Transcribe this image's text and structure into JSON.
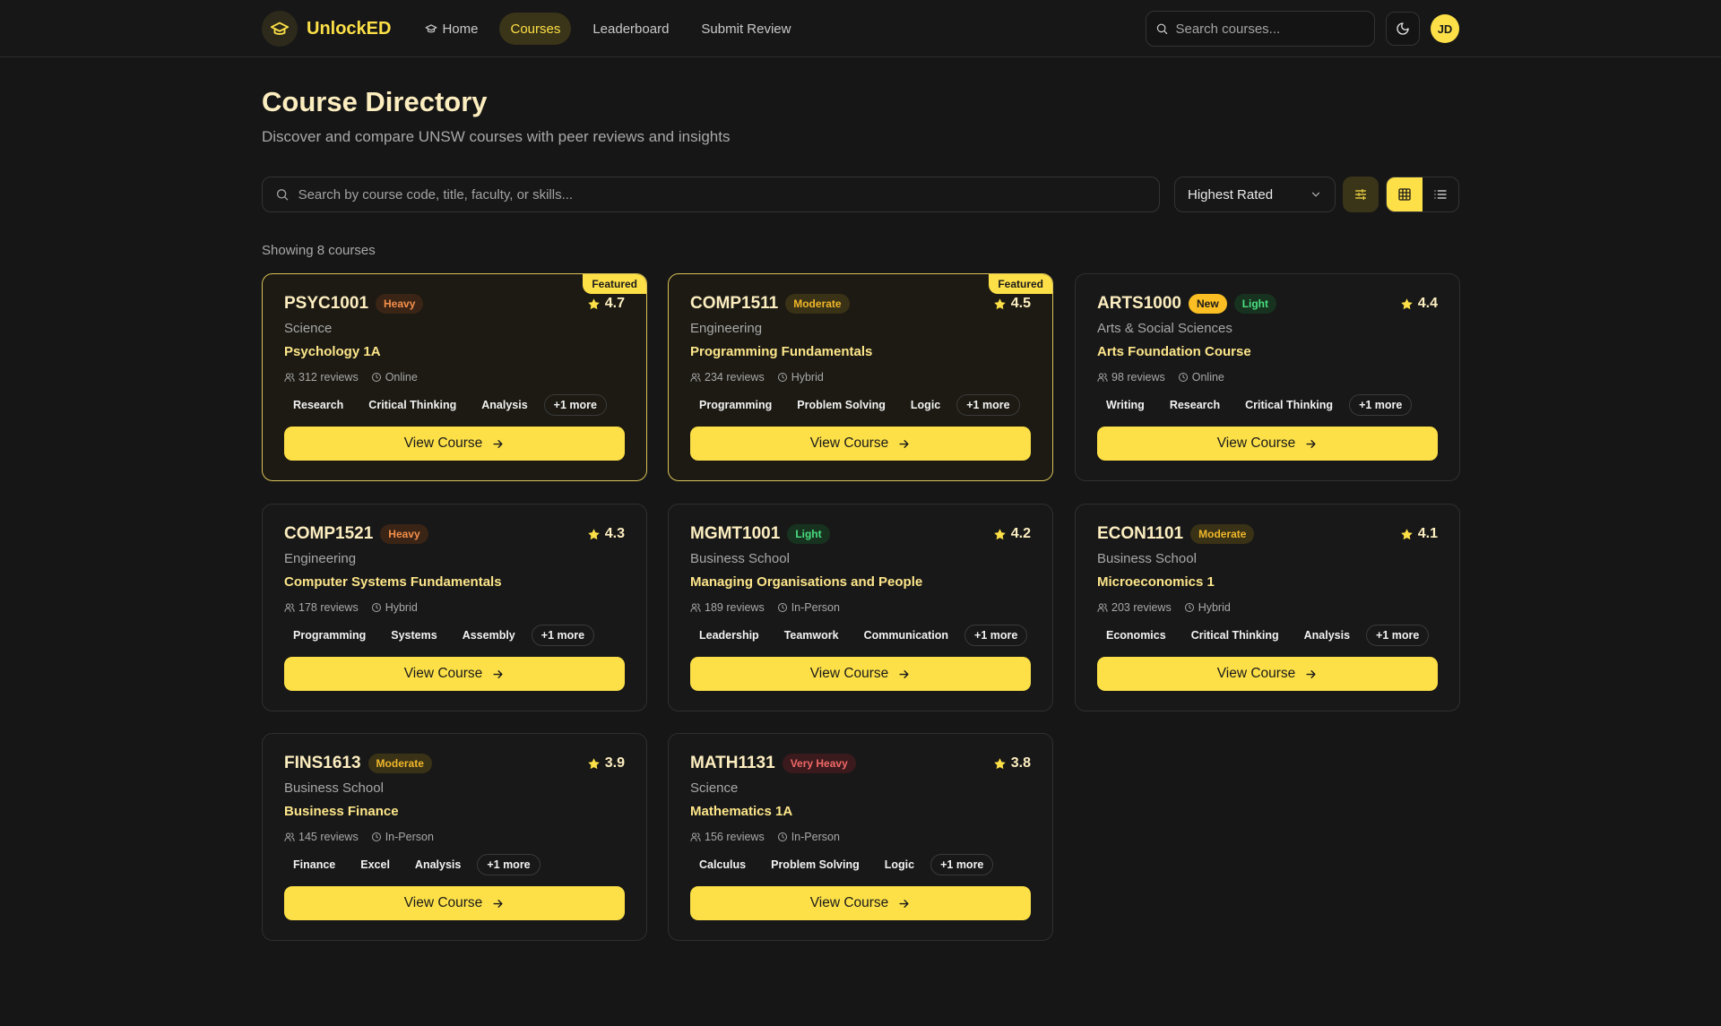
{
  "nav": {
    "brand": "UnlockED",
    "links": [
      {
        "label": "Home",
        "icon": "graduation-cap-icon",
        "active": false
      },
      {
        "label": "Courses",
        "active": true
      },
      {
        "label": "Leaderboard",
        "active": false
      },
      {
        "label": "Submit Review",
        "active": false
      }
    ],
    "search_placeholder": "Search courses...",
    "avatar_initials": "JD"
  },
  "header": {
    "title": "Course Directory",
    "subtitle": "Discover and compare UNSW courses with peer reviews and insights"
  },
  "toolbar": {
    "search_placeholder": "Search by course code, title, faculty, or skills...",
    "sort_value": "Highest Rated",
    "view_mode": "grid"
  },
  "results": {
    "showing": "Showing 8 courses"
  },
  "colors": {
    "accent": "#fde047",
    "background": "#161616",
    "card": "#181818"
  },
  "courses": [
    {
      "code": "PSYC1001",
      "workload": "Heavy",
      "new": false,
      "featured": true,
      "rating": "4.7",
      "faculty": "Science",
      "title": "Psychology 1A",
      "reviews": "312 reviews",
      "mode": "Online",
      "skills": [
        "Research",
        "Critical Thinking",
        "Analysis"
      ],
      "more": "+1 more",
      "cta": "View Course"
    },
    {
      "code": "COMP1511",
      "workload": "Moderate",
      "new": false,
      "featured": true,
      "rating": "4.5",
      "faculty": "Engineering",
      "title": "Programming Fundamentals",
      "reviews": "234 reviews",
      "mode": "Hybrid",
      "skills": [
        "Programming",
        "Problem Solving",
        "Logic"
      ],
      "more": "+1 more",
      "cta": "View Course"
    },
    {
      "code": "ARTS1000",
      "workload": "Light",
      "new": true,
      "featured": false,
      "rating": "4.4",
      "faculty": "Arts & Social Sciences",
      "title": "Arts Foundation Course",
      "reviews": "98 reviews",
      "mode": "Online",
      "skills": [
        "Writing",
        "Research",
        "Critical Thinking"
      ],
      "more": "+1 more",
      "cta": "View Course"
    },
    {
      "code": "COMP1521",
      "workload": "Heavy",
      "new": false,
      "featured": false,
      "rating": "4.3",
      "faculty": "Engineering",
      "title": "Computer Systems Fundamentals",
      "reviews": "178 reviews",
      "mode": "Hybrid",
      "skills": [
        "Programming",
        "Systems",
        "Assembly"
      ],
      "more": "+1 more",
      "cta": "View Course"
    },
    {
      "code": "MGMT1001",
      "workload": "Light",
      "new": false,
      "featured": false,
      "rating": "4.2",
      "faculty": "Business School",
      "title": "Managing Organisations and People",
      "reviews": "189 reviews",
      "mode": "In-Person",
      "skills": [
        "Leadership",
        "Teamwork",
        "Communication"
      ],
      "more": "+1 more",
      "cta": "View Course"
    },
    {
      "code": "ECON1101",
      "workload": "Moderate",
      "new": false,
      "featured": false,
      "rating": "4.1",
      "faculty": "Business School",
      "title": "Microeconomics 1",
      "reviews": "203 reviews",
      "mode": "Hybrid",
      "skills": [
        "Economics",
        "Critical Thinking",
        "Analysis"
      ],
      "more": "+1 more",
      "cta": "View Course"
    },
    {
      "code": "FINS1613",
      "workload": "Moderate",
      "new": false,
      "featured": false,
      "rating": "3.9",
      "faculty": "Business School",
      "title": "Business Finance",
      "reviews": "145 reviews",
      "mode": "In-Person",
      "skills": [
        "Finance",
        "Excel",
        "Analysis"
      ],
      "more": "+1 more",
      "cta": "View Course"
    },
    {
      "code": "MATH1131",
      "workload": "Very Heavy",
      "new": false,
      "featured": false,
      "rating": "3.8",
      "faculty": "Science",
      "title": "Mathematics 1A",
      "reviews": "156 reviews",
      "mode": "In-Person",
      "skills": [
        "Calculus",
        "Problem Solving",
        "Logic"
      ],
      "more": "+1 more",
      "cta": "View Course"
    }
  ],
  "labels": {
    "featured": "Featured",
    "new": "New"
  }
}
